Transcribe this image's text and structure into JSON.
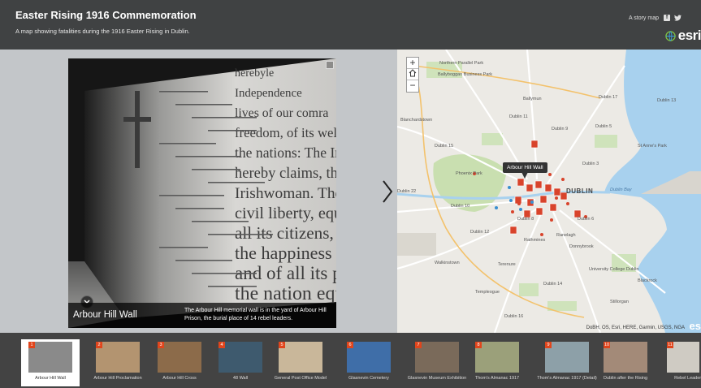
{
  "header": {
    "title": "Easter Rising 1916 Commemoration",
    "subtitle": "A map showing fatalities during the 1916 Easter Rising in Dublin.",
    "story_link": "A story map",
    "logo": "esri"
  },
  "slide": {
    "title": "Arbour Hill Wall",
    "caption": "The Arbour Hill memorial wall is in the yard of Arbour Hill Prison, the burial place of 14 rebel leaders.",
    "wall_text": [
      "herebyle",
      "Independence",
      "lives of our comra",
      "freedom, of its welfa",
      "the nations: The Iri",
      "hereby claims, the a",
      "Irishwoman. The Rep",
      "civil liberty, equal ri",
      "all its citizens, and",
      "the happiness and p",
      "and of all its parts,",
      "the nation equall"
    ]
  },
  "map": {
    "labels": {
      "northern_park": "Northern Parallel Park",
      "ballyboggan": "Ballyboggan Business Park",
      "ballymun": "Ballymun",
      "dublin11": "Dublin 11",
      "dublin9": "Dublin 9",
      "dublin17": "Dublin 17",
      "dublin13": "Dublin 13",
      "blanchardstown": "Blanchardstown",
      "dublin15": "Dublin 15",
      "dublin5": "Dublin 5",
      "dublin3": "Dublin 3",
      "stanneswood": "St Anne's Park",
      "phoenix": "Phoenix Park",
      "dublin": "DUBLIN",
      "dublin22": "Dublin 22",
      "dublin10": "Dublin 10",
      "dublin8": "Dublin 8",
      "dublin6": "Dublin 6",
      "dublinbay": "Dublin Bay",
      "rathmines": "Rathmines",
      "ranelagh": "Ranelagh",
      "donnybrook": "Donnybrook",
      "terenure": "Terenure",
      "templeogue": "Templeogue",
      "blackrock": "Blackrock",
      "stillorgan": "Stillorgan",
      "dublin14": "Dublin 14",
      "dublin16": "Dublin 16",
      "dublin12": "Dublin 12",
      "walkinstown": "Walkinstown",
      "ucd": "University College Dublin"
    },
    "tooltip": "Arbour Hill Wall",
    "attribution": "DoBH, OS, Esri, HERE, Garmin, USGS, NGA",
    "esri_mark": "es"
  },
  "thumbnails": [
    {
      "num": "1",
      "label": "Arbour Hill Wall",
      "color": "#8a8a8a"
    },
    {
      "num": "2",
      "label": "Arbour Hill Proclamation",
      "color": "#b39470"
    },
    {
      "num": "3",
      "label": "Arbour Hill Cross",
      "color": "#8c6b4a"
    },
    {
      "num": "4",
      "label": "48 Wall",
      "color": "#3e5a6e"
    },
    {
      "num": "5",
      "label": "General Post Office Model",
      "color": "#c9b79a"
    },
    {
      "num": "6",
      "label": "Glasnevin Cemetery",
      "color": "#3f6ea8"
    },
    {
      "num": "7",
      "label": "Glasnevin Museum Exhibition",
      "color": "#7a6a5a"
    },
    {
      "num": "8",
      "label": "Thom's Almanac 1917",
      "color": "#9ba07a"
    },
    {
      "num": "9",
      "label": "Thom's Almanac 1917 (Detail)",
      "color": "#8da0a8"
    },
    {
      "num": "10",
      "label": "Dublin after the Rising",
      "color": "#a38a78"
    },
    {
      "num": "11",
      "label": "Rebel Leaders",
      "color": "#cfcbc3"
    }
  ]
}
